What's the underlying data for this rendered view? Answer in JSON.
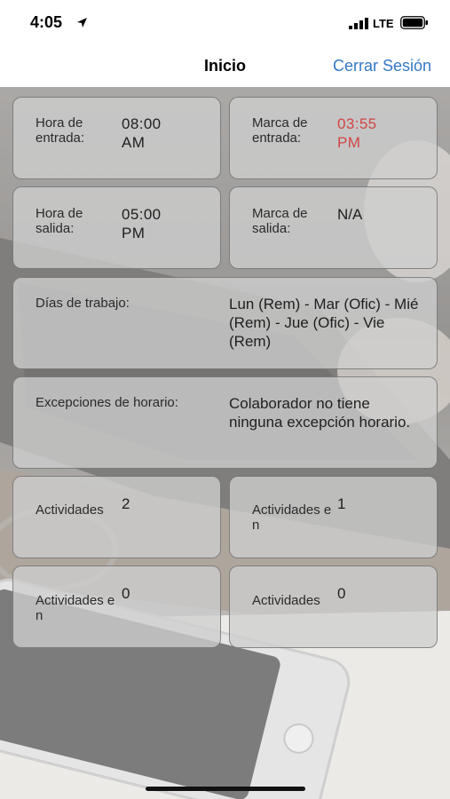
{
  "status_bar": {
    "time": "4:05",
    "network": "LTE"
  },
  "nav": {
    "title": "Inicio",
    "logout_label": "Cerrar Sesión",
    "accent_color": "#3478c6"
  },
  "cards": {
    "entry_time": {
      "label": "Hora de entrada:",
      "value": "08:00 AM"
    },
    "entry_mark": {
      "label": "Marca de entrada:",
      "value": "03:55 PM",
      "value_color": "#d14545"
    },
    "exit_time": {
      "label": "Hora de salida:",
      "value": "05:00 PM"
    },
    "exit_mark": {
      "label": "Marca de salida:",
      "value": "N/A"
    },
    "work_days": {
      "label": "Días de trabajo:",
      "value": "Lun (Rem) - Mar (Ofic) - Mié (Rem) - Jue (Ofic) - Vie (Rem)"
    },
    "exceptions": {
      "label": "Excepciones de horario:",
      "value": "Colaborador no tiene ninguna excepción horario."
    },
    "activities_1": {
      "label": "Actividades",
      "value": "2"
    },
    "activities_2": {
      "label": "Actividades en",
      "value": "1"
    },
    "activities_3": {
      "label": "Actividades en",
      "value": "0"
    },
    "activities_4": {
      "label": "Actividades",
      "value": "0"
    }
  }
}
